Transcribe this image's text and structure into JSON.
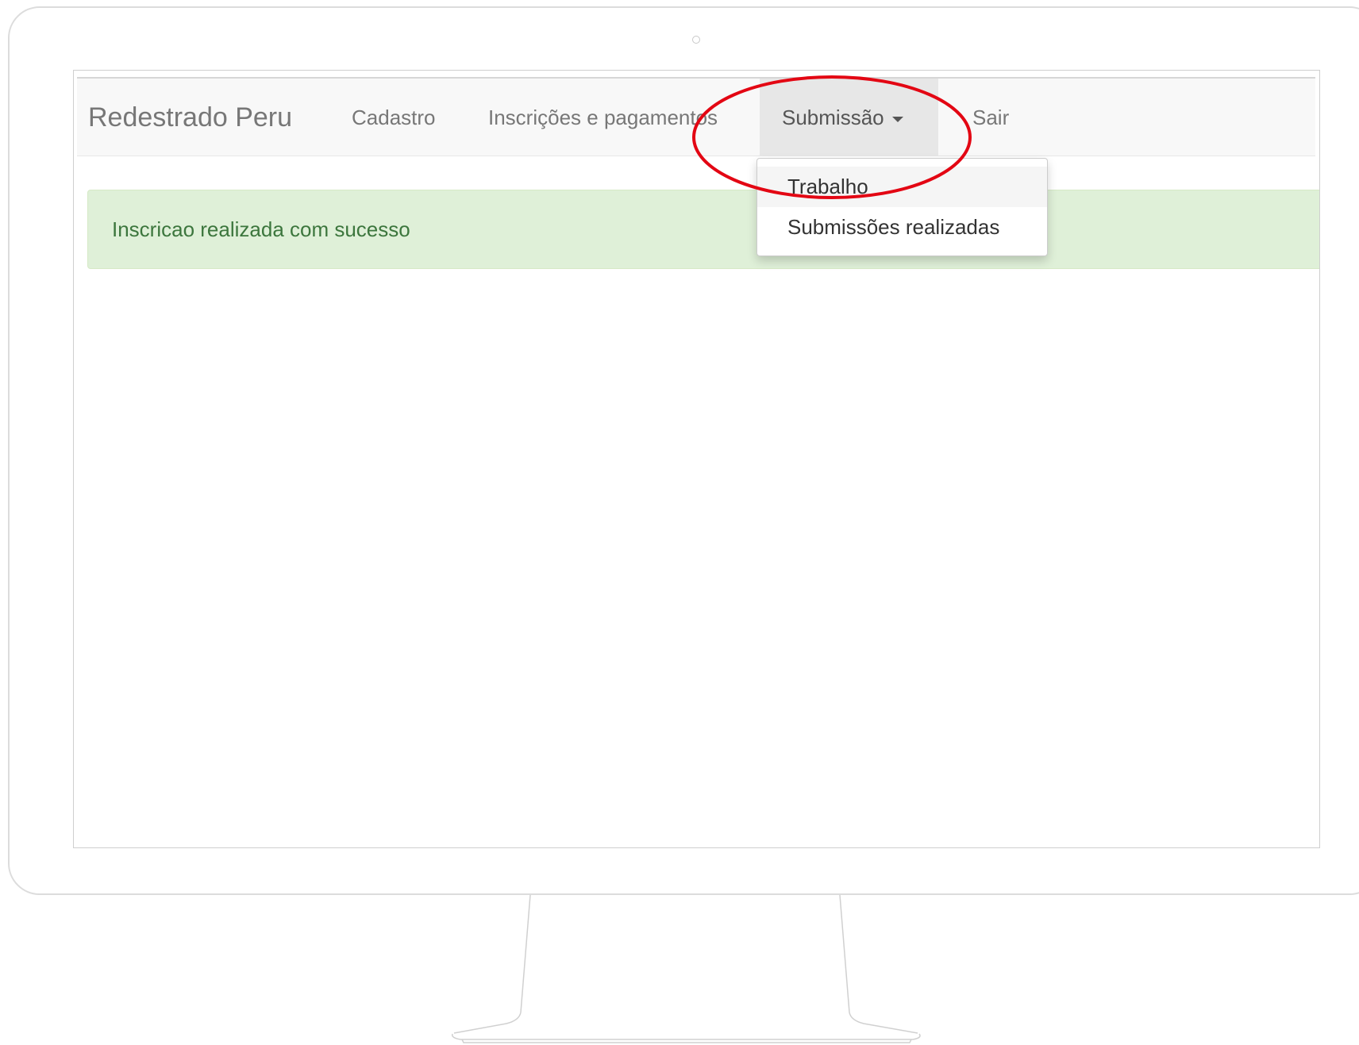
{
  "navbar": {
    "brand": "Redestrado Peru",
    "items": [
      {
        "label": "Cadastro"
      },
      {
        "label": "Inscrições e pagamentos"
      },
      {
        "label": "Submissão"
      },
      {
        "label": "Sair"
      }
    ]
  },
  "dropdown": {
    "items": [
      {
        "label": "Trabalho"
      },
      {
        "label": "Submissões realizadas"
      }
    ]
  },
  "alert": {
    "message": "Inscricao realizada com sucesso"
  },
  "colors": {
    "annotation": "#e30613",
    "alert_bg": "#dff0d8",
    "alert_text": "#3c763d",
    "navbar_bg": "#f8f8f8"
  }
}
